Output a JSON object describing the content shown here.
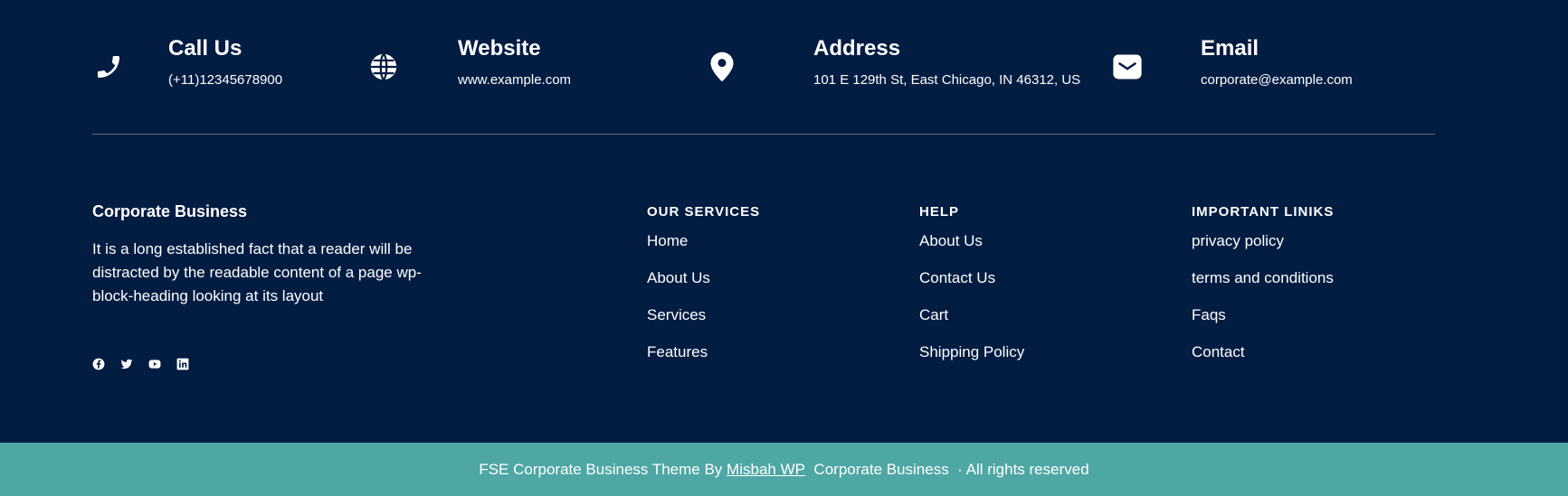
{
  "contact": {
    "items": [
      {
        "icon": "phone-icon",
        "title": "Call Us",
        "value": "(+11)12345678900"
      },
      {
        "icon": "globe-icon",
        "title": "Website",
        "value": "www.example.com"
      },
      {
        "icon": "location-pin-icon",
        "title": "Address",
        "value": "101 E 129th St, East Chicago, IN 46312, US"
      },
      {
        "icon": "envelope-icon",
        "title": "Email",
        "value": "corporate@example.com"
      }
    ]
  },
  "brand": {
    "title": "Corporate Business",
    "description": "It is a long established fact that a reader will be distracted by the readable content of a page wp-block-heading looking at its layout",
    "social": [
      "facebook-icon",
      "twitter-icon",
      "youtube-icon",
      "linkedin-icon"
    ]
  },
  "columns": [
    {
      "title": "OUR SERVICES",
      "links": [
        "Home",
        "About Us",
        "Services",
        "Features"
      ]
    },
    {
      "title": "HELP",
      "links": [
        "About Us",
        "Contact Us",
        "Cart",
        "Shipping Policy"
      ]
    },
    {
      "title": "IMPORTANT LINIKS",
      "links": [
        "privacy policy",
        "terms and conditions",
        "Faqs",
        "Contact"
      ]
    }
  ],
  "footer": {
    "prefix": "FSE Corporate Business Theme By",
    "author_link": "Misbah WP",
    "suffix": "Corporate Business  · All rights reserved"
  },
  "colors": {
    "background": "#031c42",
    "footer_bar": "#4fa7a4"
  }
}
